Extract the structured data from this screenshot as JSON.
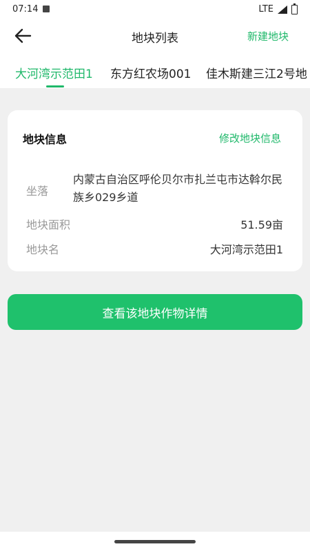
{
  "status_bar": {
    "time": "07:14",
    "network": "LTE"
  },
  "header": {
    "title": "地块列表",
    "new_plot": "新建地块",
    "back_icon": "arrow-left-icon"
  },
  "tabs": [
    {
      "label": "大河湾示范田1",
      "active": true
    },
    {
      "label": "东方红农场001",
      "active": false
    },
    {
      "label": "佳木斯建三江2号地",
      "active": false
    }
  ],
  "plot_info": {
    "title": "地块信息",
    "edit": "修改地块信息",
    "location_label": "坐落",
    "location_value": "内蒙古自治区呼伦贝尔市扎兰屯市达斡尔民族乡029乡道",
    "area_label": "地块面积",
    "area_value": "51.59亩",
    "name_label": "地块名",
    "name_value": "大河湾示范田1"
  },
  "action": {
    "label": "查看该地块作物详情"
  },
  "colors": {
    "accent": "#1fb86a",
    "button": "#1fc16c",
    "background": "#f0f0f0"
  }
}
